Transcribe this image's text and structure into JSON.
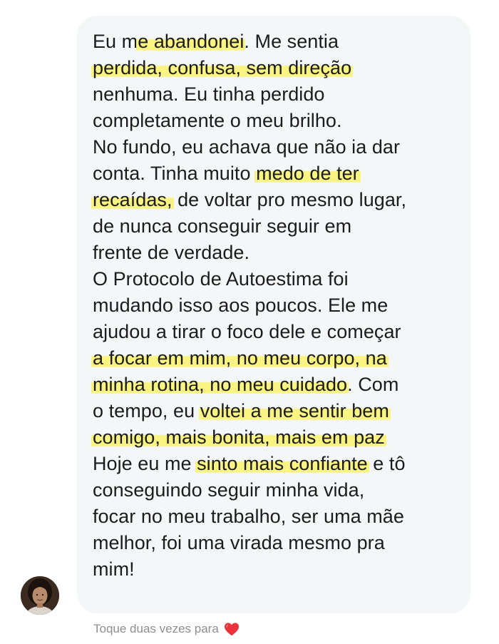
{
  "message": {
    "paragraphs": [
      {
        "lines": [
          [
            {
              "t": "Eu m"
            },
            {
              "t": "e abandonei",
              "hl": true
            },
            {
              "t": ". Me sentia"
            }
          ],
          [
            {
              "t": "perdida, confusa, sem direção",
              "hl": true
            }
          ],
          [
            {
              "t": "nenhuma. Eu tinha perdido"
            }
          ],
          [
            {
              "t": "completamente o meu brilho."
            }
          ]
        ]
      },
      {
        "lines": [
          [
            {
              "t": "No fundo, eu achava que não ia dar"
            }
          ],
          [
            {
              "t": "conta. Tinha muito "
            },
            {
              "t": "medo de ter",
              "hl": true
            }
          ],
          [
            {
              "t": "recaídas,",
              "hl": true
            },
            {
              "t": " de voltar pro mesmo lugar,"
            }
          ],
          [
            {
              "t": "de nunca conseguir seguir em"
            }
          ],
          [
            {
              "t": "frente de verdade."
            }
          ]
        ]
      },
      {
        "lines": [
          [
            {
              "t": "O Protocolo de Autoestima foi"
            }
          ],
          [
            {
              "t": "mudando isso aos poucos. Ele me"
            }
          ],
          [
            {
              "t": "ajudou a tirar o foco dele e começar"
            }
          ],
          [
            {
              "t": "a focar em mim, no meu corpo, na",
              "hl": true
            }
          ],
          [
            {
              "t": "minha rotina, no meu cuidado",
              "hl": true
            },
            {
              "t": ". Com"
            }
          ],
          [
            {
              "t": "o tempo, eu "
            },
            {
              "t": "voltei a me sentir bem",
              "hl": true
            }
          ],
          [
            {
              "t": "comigo, mais bonita, mais em paz",
              "hl": true
            }
          ],
          [
            {
              "t": "Hoje eu me "
            },
            {
              "t": "sinto mais confiante",
              "hl": true
            },
            {
              "t": " e tô"
            }
          ],
          [
            {
              "t": "conseguindo seguir minha vida,"
            }
          ],
          [
            {
              "t": "focar no meu trabalho, ser uma mãe"
            }
          ],
          [
            {
              "t": "melhor, foi uma virada mesmo pra"
            }
          ],
          [
            {
              "t": "mim!"
            }
          ]
        ]
      }
    ]
  },
  "reaction_hint": {
    "text": "Toque duas vezes para",
    "icon": "heart-icon"
  },
  "colors": {
    "bubble": "#f4f7f8",
    "highlight": "#faf36e",
    "text": "#1c1c1e",
    "hint": "#8e8e93",
    "heart": "#e8343a"
  }
}
